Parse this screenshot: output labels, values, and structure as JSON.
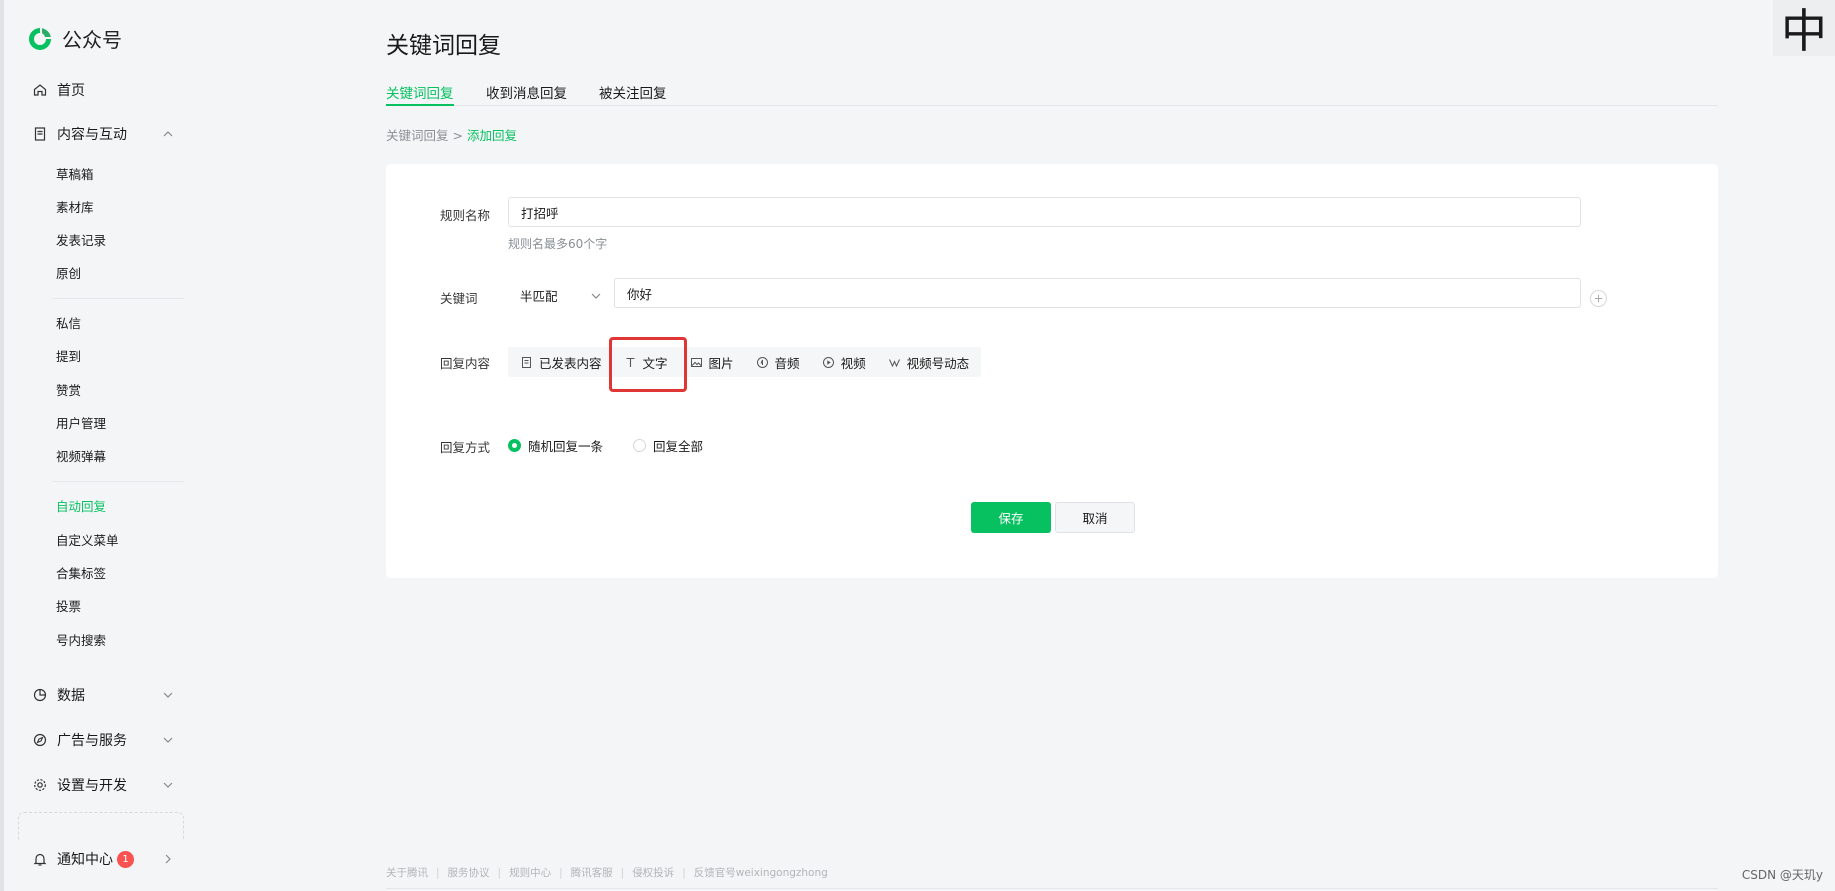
{
  "app": {
    "name": "公众号"
  },
  "sidebar": {
    "home": "首页",
    "content_group": "内容与互动",
    "content_items": [
      "草稿箱",
      "素材库",
      "发表记录",
      "原创"
    ],
    "interact_items": [
      "私信",
      "提到",
      "赞赏",
      "用户管理",
      "视频弹幕"
    ],
    "feature_items": [
      "自动回复",
      "自定义菜单",
      "合集标签",
      "投票",
      "号内搜索"
    ],
    "data": "数据",
    "ads": "广告与服务",
    "settings": "设置与开发",
    "notifications": "通知中心",
    "notification_count": "1"
  },
  "page": {
    "title": "关键词回复",
    "tabs": [
      "关键词回复",
      "收到消息回复",
      "被关注回复"
    ],
    "breadcrumb_parent": "关键词回复",
    "breadcrumb_sep": ">",
    "breadcrumb_current": "添加回复"
  },
  "form": {
    "rule_label": "规则名称",
    "rule_value": "打招呼",
    "rule_hint": "规则名最多60个字",
    "keyword_label": "关键词",
    "match_mode": "半匹配",
    "keyword_value": "你好",
    "reply_label": "回复内容",
    "reply_types": [
      "已发表内容",
      "文字",
      "图片",
      "音频",
      "视频",
      "视频号动态"
    ],
    "mode_label": "回复方式",
    "mode_options": [
      "随机回复一条",
      "回复全部"
    ],
    "save": "保存",
    "cancel": "取消"
  },
  "footer": {
    "links": [
      "关于腾讯",
      "服务协议",
      "规则中心",
      "腾讯客服",
      "侵权投诉"
    ],
    "feedback": "反馈官号weixingongzhong"
  },
  "overlay": {
    "ime": "中",
    "watermark": "CSDN @天玑y"
  },
  "colors": {
    "accent": "#07c160",
    "highlight": "#e03535",
    "badge": "#fa5151"
  }
}
